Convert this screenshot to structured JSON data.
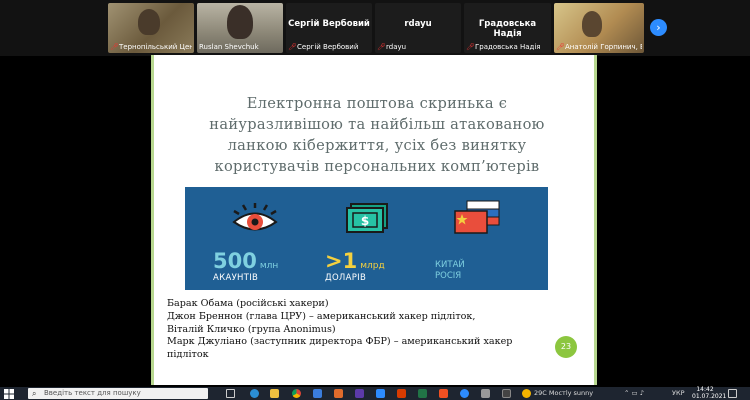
{
  "participants": [
    {
      "name": "Тернопільський Цен...",
      "video": true,
      "muted": true
    },
    {
      "name": "Ruslan Shevchuk",
      "video": true,
      "muted": false
    },
    {
      "name": "Сергій Вербовий",
      "video": false,
      "muted": true,
      "display_name": "Сергій Вербовий"
    },
    {
      "name": "rdayu",
      "video": false,
      "muted": true,
      "display_name": "rdayu"
    },
    {
      "name": "Градовська Надія",
      "video": false,
      "muted": true,
      "display_name": "Градовська Надія"
    },
    {
      "name": "Анатолій Горпинич, В...",
      "video": true,
      "muted": true
    }
  ],
  "slide": {
    "title_lines": [
      "Електронна поштова скринька є",
      "найуразливішою та найбільш атакованою",
      "ланкою кібержиття, усіх без винятку",
      "користувачів персональних комп’ютерів"
    ],
    "stats": [
      {
        "number": "500",
        "unit": "млн",
        "label": "АКАУНТІВ",
        "icon": "eye-icon"
      },
      {
        "number": ">1",
        "unit": "млрд",
        "label": "ДОЛАРІВ",
        "icon": "money-icon"
      },
      {
        "number": "",
        "unit": "",
        "label_lines": [
          "КИТАЙ",
          "РОСІЯ"
        ],
        "icon": "flags-icon"
      }
    ],
    "body_lines": [
      "Барак Обама (російські хакери)",
      "Джон Бреннон (глава ЦРУ) – американський хакер підліток,",
      "Віталій Кличко (група Anonimus)",
      "Марк Джуліано (заступник директора ФБР) – американський хакер",
      "підліток"
    ],
    "page_number": "23"
  },
  "taskbar": {
    "search_placeholder": "Введіть текст для пошуку",
    "weather": "29C  Мостly sunny",
    "language": "УКР",
    "time": "14:42",
    "date": "01.07.2021"
  },
  "colors": {
    "banner": "#1f5f94",
    "accent_cyan": "#7fd0e0",
    "accent_yellow": "#f4d03f",
    "page_badge": "#8cc63f",
    "zoom_blue": "#2d8cff"
  }
}
